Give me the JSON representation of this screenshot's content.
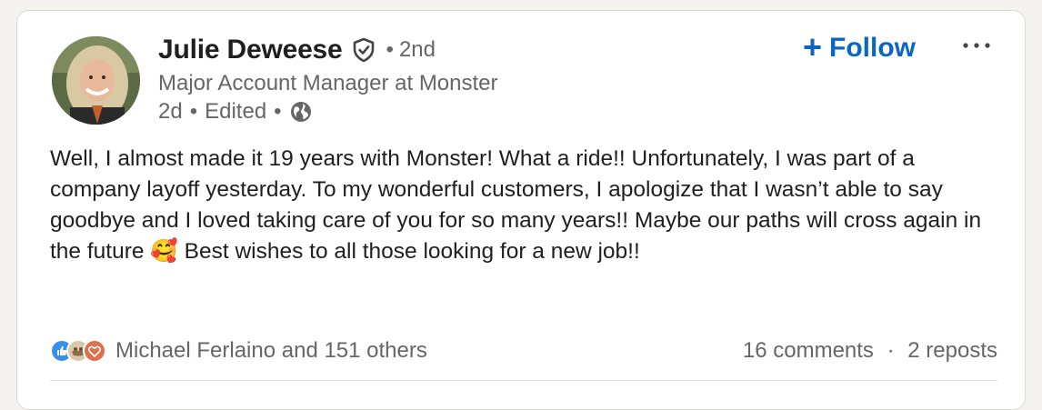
{
  "author": {
    "name": "Julie Deweese",
    "degree": "2nd",
    "degree_separator": "•",
    "headline": "Major Account Manager at Monster",
    "posted": "2d",
    "edited": "Edited",
    "meta_separator": "•",
    "visibility_icon": "globe-icon",
    "verified_icon": "shield-check-icon"
  },
  "actions": {
    "follow_label": "Follow",
    "follow_icon": "+",
    "more_icon": "ellipsis-icon"
  },
  "post": {
    "text": "Well, I almost made it 19 years with Monster! What a ride!! Unfortunately, I was part of a company layoff yesterday. To my wonderful customers, I apologize that I wasn’t able to say goodbye and I loved taking care of you for so many years!! Maybe our paths will cross again in the future 🥰 Best wishes to all those looking for a new job!!"
  },
  "social": {
    "reaction_icons": [
      "like-icon",
      "support-icon",
      "love-icon"
    ],
    "reactions_text": "Michael Ferlaino and 151 others",
    "comments": "16 comments",
    "separator": "·",
    "reposts": "2 reposts"
  },
  "colors": {
    "accent": "#0a66c2",
    "text_primary": "#1f1f1f",
    "text_secondary": "#666666",
    "like": "#378fe9",
    "love": "#df704d"
  }
}
